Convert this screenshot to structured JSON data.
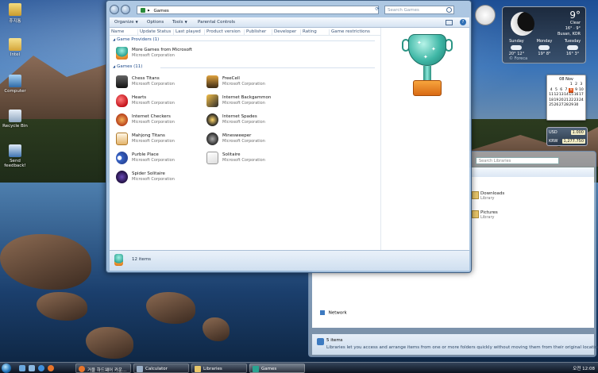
{
  "desktop": {
    "icons": [
      {
        "label": "휴지통",
        "icon": "recycle-folder-icon"
      },
      {
        "label": "Intel",
        "icon": "folder-icon"
      },
      {
        "label": "Computer",
        "icon": "computer-icon"
      },
      {
        "label": "Recycle Bin",
        "icon": "recycle-bin-icon"
      },
      {
        "label": "Send feedback!",
        "icon": "feedback-icon"
      }
    ]
  },
  "games_window": {
    "address": {
      "separator": "▸",
      "location": "Games"
    },
    "search_placeholder": "Search Games",
    "toolbar": {
      "organize": "Organize",
      "options": "Options",
      "tools": "Tools",
      "parental_controls": "Parental Controls"
    },
    "columns": [
      "Name",
      "Update Status",
      "Last played",
      "Product version",
      "Publisher",
      "Developer",
      "Rating",
      "Game restrictions"
    ],
    "groups": {
      "providers": {
        "label": "Game Providers (1)"
      },
      "games": {
        "label": "Games (11)"
      }
    },
    "providers": [
      {
        "name": "More Games from Microsoft",
        "publisher": "Microsoft Corporation"
      }
    ],
    "games": [
      {
        "name": "Chess Titans",
        "publisher": "Microsoft Corporation"
      },
      {
        "name": "FreeCell",
        "publisher": "Microsoft Corporation"
      },
      {
        "name": "Hearts",
        "publisher": "Microsoft Corporation"
      },
      {
        "name": "Internet Backgammon",
        "publisher": "Microsoft Corporation"
      },
      {
        "name": "Internet Checkers",
        "publisher": "Microsoft Corporation"
      },
      {
        "name": "Internet Spades",
        "publisher": "Microsoft Corporation"
      },
      {
        "name": "Mahjong Titans",
        "publisher": "Microsoft Corporation"
      },
      {
        "name": "Minesweeper",
        "publisher": "Microsoft Corporation"
      },
      {
        "name": "Purble Place",
        "publisher": "Microsoft Corporation"
      },
      {
        "name": "Solitaire",
        "publisher": "Microsoft Corporation"
      },
      {
        "name": "Spider Solitaire",
        "publisher": "Microsoft Corporation"
      }
    ],
    "details": {
      "item_count": "12 items"
    }
  },
  "libraries_window": {
    "search_placeholder": "Search Libraries",
    "items": [
      {
        "name": "Downloads",
        "type": "Library"
      },
      {
        "name": "Pictures",
        "type": "Library"
      }
    ],
    "network": "Network",
    "status": {
      "count": "5 items",
      "description": "Libraries let you access and arrange items from one or more folders quickly without moving them from their original locations."
    }
  },
  "weather": {
    "temp": "9°",
    "condition": "Clear",
    "range": "16° · 9°",
    "city": "Busan, KOR",
    "forecast": [
      {
        "day": "Sunday",
        "high": "20°",
        "low": "12°"
      },
      {
        "day": "Monday",
        "high": "19°",
        "low": "8°"
      },
      {
        "day": "Tuesday",
        "high": "16°",
        "low": "3°"
      }
    ],
    "provider": "© Foreca"
  },
  "calendar": {
    "month": "08 Nov",
    "days": [
      "",
      "",
      "",
      "",
      "1",
      "2",
      "3",
      "4",
      "5",
      "6",
      "7",
      "8",
      "9",
      "10",
      "11",
      "12",
      "13",
      "14",
      "15",
      "16",
      "17",
      "18",
      "19",
      "20",
      "21",
      "22",
      "23",
      "24",
      "25",
      "26",
      "27",
      "28",
      "29",
      "30"
    ],
    "today": "8"
  },
  "currency": {
    "rows": [
      {
        "code": "USD",
        "value": "1.000"
      },
      {
        "code": "KRW",
        "value": "1,277.750"
      }
    ]
  },
  "taskbar": {
    "buttons": [
      {
        "label": "거울 하드웨어 카운...",
        "icon": "firefox-icon"
      },
      {
        "label": "Calculator",
        "icon": "calculator-icon"
      },
      {
        "label": "Libraries",
        "icon": "libraries-icon"
      },
      {
        "label": "Games",
        "icon": "games-icon"
      }
    ],
    "clock": "오전 12:08"
  },
  "colors": {
    "accent": "#1e4a8a",
    "toolbar_text": "#1b2f4a",
    "secondary_text": "#6d6d6d"
  }
}
